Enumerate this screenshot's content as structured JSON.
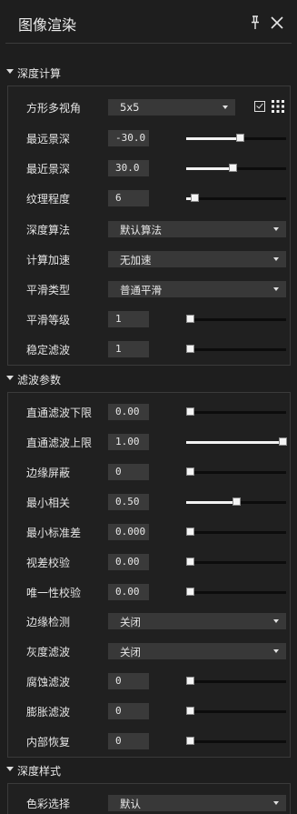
{
  "window": {
    "title": "图像渲染",
    "pin_icon": "pin-icon",
    "close_icon": "close-icon"
  },
  "sections": {
    "depth_calc": {
      "title": "深度计算",
      "angle": {
        "label": "方形多视角",
        "value": "5x5",
        "checked": true,
        "grid_icon": "grid-icon"
      },
      "far": {
        "label": "最远景深",
        "value": "-30.0",
        "level": 0.54
      },
      "near": {
        "label": "最近景深",
        "value": "30.0",
        "level": 0.46
      },
      "texture": {
        "label": "纹理程度",
        "value": "6",
        "level": 0.05
      },
      "algo": {
        "label": "深度算法",
        "value": "默认算法"
      },
      "accel": {
        "label": "计算加速",
        "value": "无加速"
      },
      "smooth_type": {
        "label": "平滑类型",
        "value": "普通平滑"
      },
      "smooth_level": {
        "label": "平滑等级",
        "value": "1",
        "level": 0.0
      },
      "stable_filter": {
        "label": "稳定滤波",
        "value": "1",
        "level": 0.0
      }
    },
    "filter": {
      "title": "滤波参数",
      "lp_low": {
        "label": "直通滤波下限",
        "value": "0.00",
        "level": 0.0
      },
      "lp_high": {
        "label": "直通滤波上限",
        "value": "1.00",
        "level": 1.0
      },
      "edge_mask": {
        "label": "边缘屏蔽",
        "value": "0",
        "level": 0.0
      },
      "min_corr": {
        "label": "最小相关",
        "value": "0.50",
        "level": 0.5
      },
      "min_std": {
        "label": "最小标准差",
        "value": "0.000",
        "level": 0.0
      },
      "disparity": {
        "label": "视差校验",
        "value": "0.00",
        "level": 0.0
      },
      "uniqueness": {
        "label": "唯一性校验",
        "value": "0.00",
        "level": 0.0
      },
      "edge_detect": {
        "label": "边缘检测",
        "value": "关闭"
      },
      "gray_filter": {
        "label": "灰度滤波",
        "value": "关闭"
      },
      "erode": {
        "label": "腐蚀滤波",
        "value": "0",
        "level": 0.0
      },
      "dilate": {
        "label": "膨胀滤波",
        "value": "0",
        "level": 0.0
      },
      "inner_restore": {
        "label": "内部恢复",
        "value": "0",
        "level": 0.0
      }
    },
    "style": {
      "title": "深度样式",
      "color": {
        "label": "色彩选择",
        "value": "默认"
      }
    }
  }
}
